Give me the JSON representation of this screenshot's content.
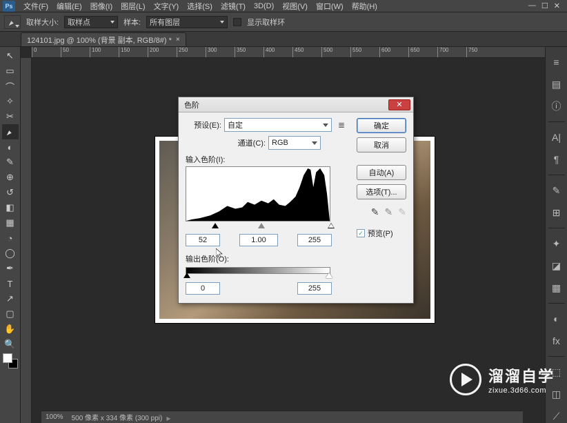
{
  "app": {
    "logo": "Ps"
  },
  "menu": {
    "items": [
      "文件(F)",
      "编辑(E)",
      "图像(I)",
      "图层(L)",
      "文字(Y)",
      "选择(S)",
      "滤镜(T)",
      "3D(D)",
      "视图(V)",
      "窗口(W)",
      "帮助(H)"
    ]
  },
  "options": {
    "sample_label": "取样大小:",
    "sample_value": "取样点",
    "sample2_label": "样本:",
    "sample2_value": "所有图层",
    "ring_label": "显示取样环"
  },
  "tab": {
    "title": "124101.jpg @ 100% (背景 副本, RGB/8#) *"
  },
  "ruler_ticks": [
    "0",
    "50",
    "100",
    "150",
    "200",
    "250",
    "300",
    "350",
    "400",
    "450",
    "500",
    "550",
    "600",
    "650",
    "700",
    "750"
  ],
  "dialog": {
    "title": "色阶",
    "preset_label": "预设(E):",
    "preset_value": "自定",
    "channel_label": "通道(C):",
    "channel_value": "RGB",
    "input_label": "输入色阶(I):",
    "input_black": "52",
    "input_gamma": "1.00",
    "input_white": "255",
    "output_label": "输出色阶(O):",
    "output_black": "0",
    "output_white": "255",
    "btn_ok": "确定",
    "btn_cancel": "取消",
    "btn_auto": "自动(A)",
    "btn_options": "选项(T)...",
    "preview_label": "预览(P)",
    "preview_checked": true
  },
  "status": {
    "zoom": "100%",
    "info": "500 像素 x 334 像素 (300 ppi)"
  },
  "watermark": {
    "cn": "溜溜自学",
    "url": "zixue.3d66.com"
  }
}
